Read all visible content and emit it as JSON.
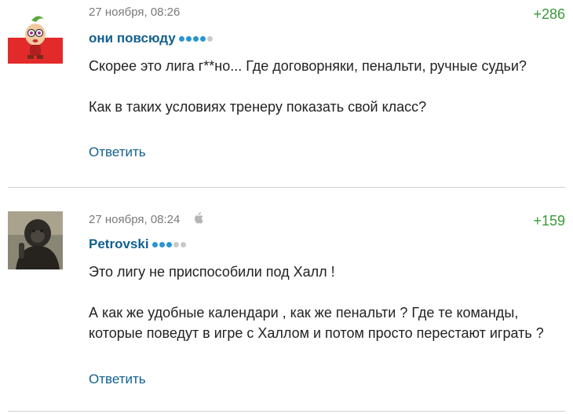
{
  "comments": [
    {
      "date": "27 ноября, 08:26",
      "votes": "+286",
      "author": "они повсюду",
      "rating": {
        "filled": 4,
        "total": 5
      },
      "paragraphs": [
        "Скорее это лига г**но... Где договорняки, пенальти, ручные судьи?",
        "Как в таких условиях тренеру показать свой класс?"
      ],
      "reply_label": "Ответить",
      "avatar_icon": "cartoon-girl-avatar"
    },
    {
      "date": "27 ноября, 08:24",
      "votes": "+159",
      "author": "Petrovski",
      "rating": {
        "filled": 3,
        "total": 5
      },
      "paragraphs": [
        "Это лигу не приспособили под Халл !",
        "А как же удобные календари , как же пенальти ? Где те команды, которые поведут в игре с Халлом и потом просто перестают играть ?"
      ],
      "reply_label": "Ответить",
      "avatar_icon": "gorilla-photo-avatar",
      "device_icon": "apple-icon"
    }
  ],
  "colors": {
    "link": "#12608f",
    "votes": "#3a9a3a",
    "rating_on": "#2a95d0",
    "rating_off": "#c9c9c9"
  }
}
